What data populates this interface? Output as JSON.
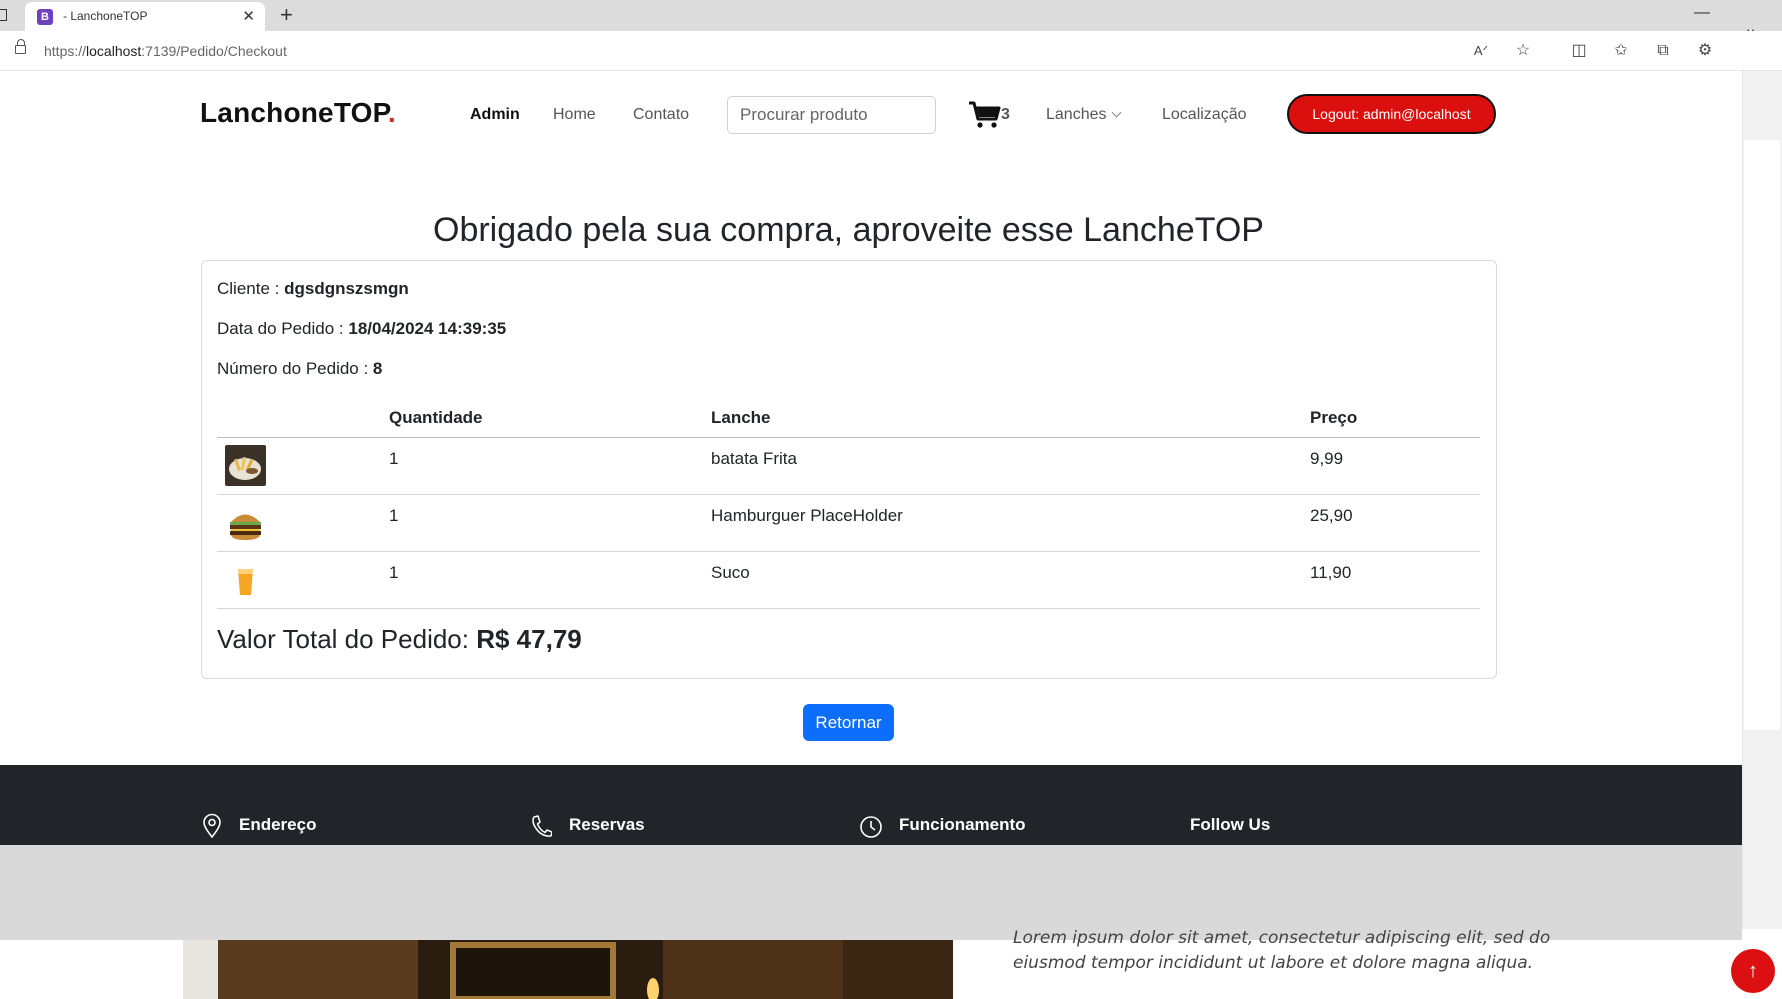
{
  "browser": {
    "tab_title": "- LanchoneTOP",
    "tab_favicon": "B",
    "url_scheme": "https://",
    "url_host": "localhost",
    "url_path": ":7139/Pedido/Checkout"
  },
  "navbar": {
    "brand": "LanchoneTOP",
    "brand_dot": ".",
    "links": [
      "Admin",
      "Home",
      "Contato"
    ],
    "search_placeholder": "Procurar produto",
    "cart_count": "3",
    "lanches": "Lanches",
    "localizacao": "Localização",
    "logout": "Logout: admin@localhost"
  },
  "checkout": {
    "title": "Obrigado pela sua compra, aproveite esse LancheTOP",
    "cliente_label": "Cliente : ",
    "cliente_value": "dgsdgnszsmgn",
    "data_label": "Data do Pedido : ",
    "data_value": "18/04/2024 14:39:35",
    "numero_label": "Número do Pedido : ",
    "numero_value": "8",
    "table": {
      "headers": [
        "Quantidade",
        "Lanche",
        "Preço"
      ],
      "rows": [
        {
          "image": "fries-image",
          "quantidade": "1",
          "lanche": "batata Frita",
          "preco": "9,99"
        },
        {
          "image": "burger-image",
          "quantidade": "1",
          "lanche": "Hamburguer PlaceHolder",
          "preco": "25,90"
        },
        {
          "image": "juice-image",
          "quantidade": "1",
          "lanche": "Suco",
          "preco": "11,90"
        }
      ]
    },
    "total_label": "Valor Total do Pedido: ",
    "total_value": "R$ 47,79",
    "return_button": "Retornar"
  },
  "footer": {
    "endereco": "Endereço",
    "reservas": "Reservas",
    "funcionamento": "Funcionamento",
    "follow": "Follow Us"
  },
  "about": {
    "lorem_line1": "Lorem ipsum dolor sit amet, consectetur adipiscing elit, sed do",
    "lorem_line2": "eiusmod tempor incididunt ut labore et dolore magna aliqua."
  },
  "colors": {
    "accent_red": "#dc0f0f",
    "primary_blue": "#0d6efd",
    "footer_dark": "#212529"
  },
  "icons": [
    "lock-icon",
    "read-aloud-icon",
    "favorite-star-icon",
    "split-screen-icon",
    "favorites-icon",
    "collections-icon",
    "extensions-icon",
    "cart-icon",
    "location-pin-icon",
    "phone-icon",
    "clock-icon",
    "arrow-up-icon"
  ]
}
